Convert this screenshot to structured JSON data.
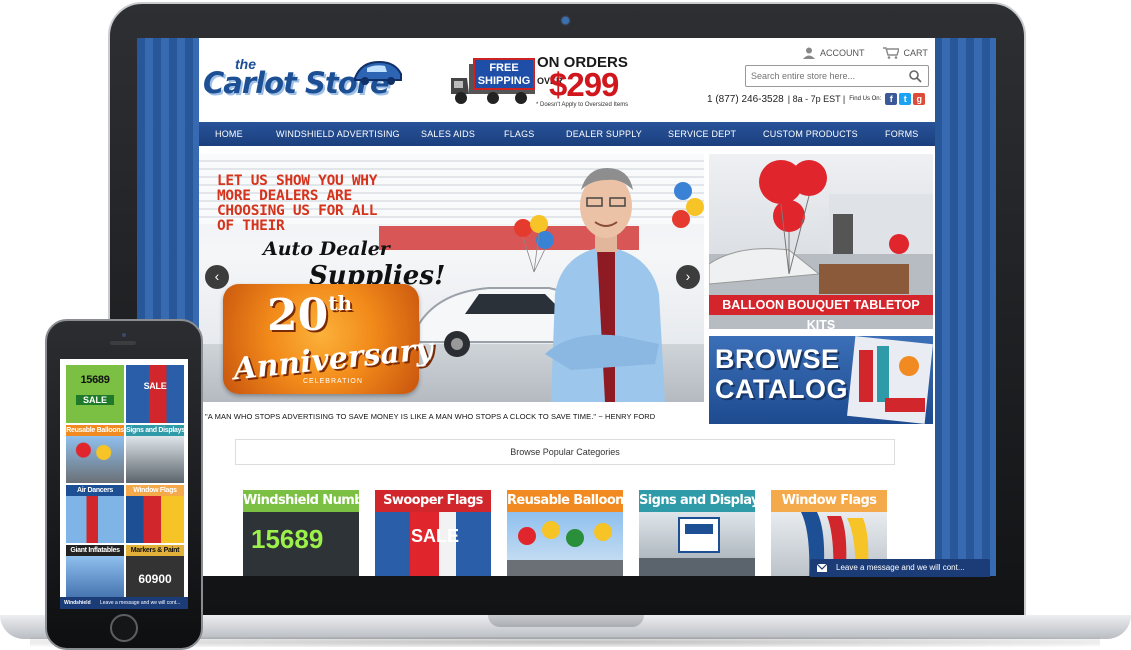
{
  "header": {
    "logo_small": "the",
    "logo_name": "Carlot Store",
    "promo_free": "FREE",
    "promo_shipping": "SHIPPING",
    "promo_on_orders": "ON ORDERS",
    "promo_over": "OVER",
    "promo_price": "$299",
    "promo_note": "* Doesn't Apply to Oversized Items",
    "account_label": "ACCOUNT",
    "cart_label": "CART",
    "search_placeholder": "Search entire store here...",
    "phone": "1 (877) 246-3528",
    "hours": "| 8a - 7p EST |",
    "find_us": "Find Us On:"
  },
  "nav": [
    "HOME",
    "WINDSHIELD ADVERTISING",
    "SALES AIDS",
    "FLAGS",
    "DEALER SUPPLY",
    "SERVICE DEPT",
    "CUSTOM PRODUCTS",
    "FORMS"
  ],
  "hero": {
    "headline_lines": [
      "LET US SHOW YOU WHY",
      "MORE DEALERS ARE",
      "CHOOSING US FOR ALL",
      "OF THEIR"
    ],
    "auto_dealer": "Auto Dealer",
    "supplies": "Supplies!",
    "anniv_number": "20",
    "anniv_suffix": "th",
    "anniv_word": "Anniversary",
    "anniv_sub": "CELEBRATION",
    "prev": "‹",
    "next": "›"
  },
  "banners": {
    "balloon": "BALLOON BOUQUET TABLETOP KITS",
    "browse_1": "BROWSE",
    "browse_2": "CATALOG"
  },
  "quote": "\"A MAN WHO STOPS ADVERTISING TO SAVE MONEY IS LIKE A MAN WHO STOPS A CLOCK TO SAVE TIME.\" ~ HENRY FORD",
  "popular_label": "Browse Popular Categories",
  "categories": [
    {
      "title": "Windshield Numbers",
      "color": "#7bc043",
      "image_text": "15689"
    },
    {
      "title": "Swooper Flags",
      "color": "#d0262c",
      "image_text": "SALE"
    },
    {
      "title": "Reusable Balloons",
      "color": "#f18b21",
      "image_text": ""
    },
    {
      "title": "Signs and Displays",
      "color": "#2f9aa8",
      "image_text": ""
    },
    {
      "title": "Window Flags",
      "color": "#f4a94a",
      "image_text": ""
    }
  ],
  "chat_label": "Leave a message and we will cont...",
  "mobile": {
    "tiles": [
      {
        "title": "15689",
        "sub": "SALE",
        "color": "#7bc043"
      },
      {
        "title": "SALE",
        "sub": "",
        "color": "#d0262c"
      },
      {
        "title": "Reusable Balloons",
        "sub": "",
        "color": "#f18b21"
      },
      {
        "title": "Signs and Displays",
        "sub": "",
        "color": "#2f9aa8"
      },
      {
        "title": "Air Dancers",
        "sub": "",
        "color": "#1d4f94"
      },
      {
        "title": "Window Flags",
        "sub": "",
        "color": "#f4a94a"
      },
      {
        "title": "Giant Inflatables",
        "sub": "",
        "color": "#222222"
      },
      {
        "title": "Markers & Paint",
        "sub": "60900",
        "color": "#e2b13a"
      }
    ],
    "bottom_label": "Windshield",
    "chat_label": "Leave a message and we will cont..."
  },
  "colors": {
    "brand_blue": "#1d4f94",
    "nav_blue": "#28539a",
    "accent_red": "#d5252c",
    "accent_orange": "#f28a1a"
  }
}
